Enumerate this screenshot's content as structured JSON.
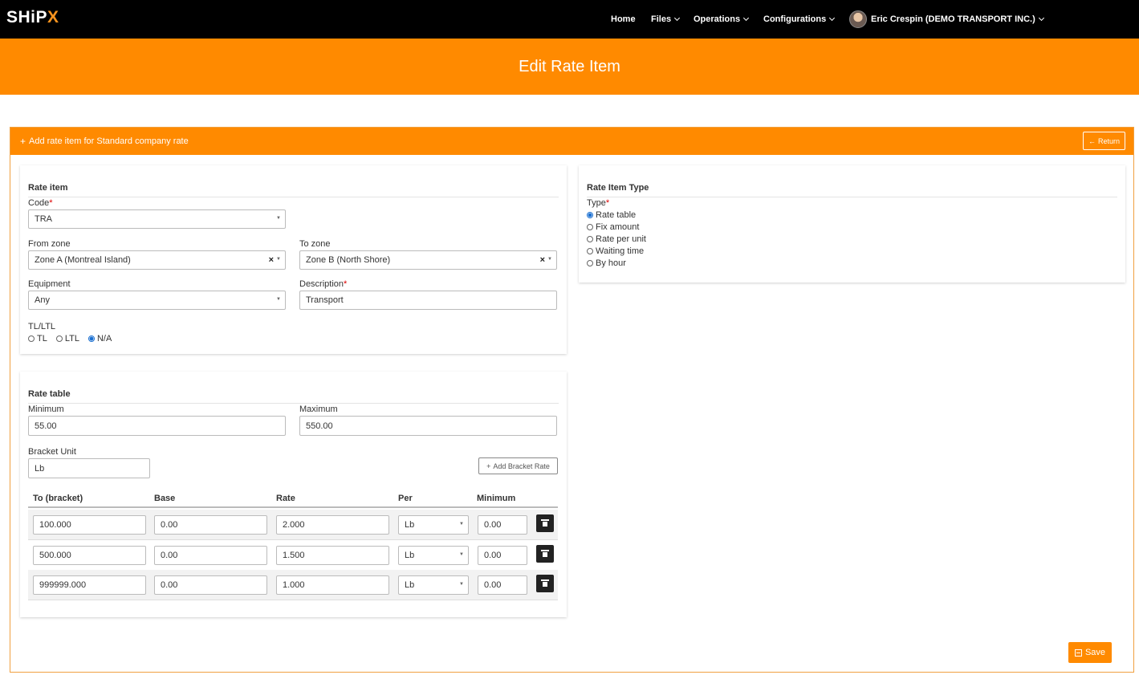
{
  "app": {
    "logo_main": "SHiP",
    "logo_x": "X"
  },
  "nav": {
    "home": "Home",
    "files": "Files",
    "operations": "Operations",
    "configurations": "Configurations",
    "user": "Eric Crespin (DEMO TRANSPORT INC.)"
  },
  "page": {
    "title": "Edit Rate Item"
  },
  "panel": {
    "title": "Add rate item for Standard company rate",
    "return_label": "Return",
    "save_label": "Save"
  },
  "rate_item": {
    "title": "Rate item",
    "code_label": "Code",
    "code_value": "TRA",
    "from_zone_label": "From zone",
    "from_zone_value": "Zone A (Montreal Island)",
    "to_zone_label": "To zone",
    "to_zone_value": "Zone B (North Shore)",
    "equipment_label": "Equipment",
    "equipment_value": "Any",
    "description_label": "Description",
    "description_value": "Transport",
    "tl_ltl_label": "TL/LTL",
    "tl_ltl_options": [
      "TL",
      "LTL",
      "N/A"
    ],
    "tl_ltl_selected": "N/A"
  },
  "rate_item_type": {
    "title": "Rate Item Type",
    "type_label": "Type",
    "options": [
      "Rate table",
      "Fix amount",
      "Rate per unit",
      "Waiting time",
      "By hour"
    ],
    "selected": "Rate table"
  },
  "rate_table": {
    "title": "Rate table",
    "minimum_label": "Minimum",
    "minimum_value": "55.00",
    "maximum_label": "Maximum",
    "maximum_value": "550.00",
    "bracket_unit_label": "Bracket Unit",
    "bracket_unit_value": "Lb",
    "add_bracket_label": "Add Bracket Rate",
    "columns": [
      "To (bracket)",
      "Base",
      "Rate",
      "Per",
      "Minimum"
    ],
    "rows": [
      {
        "to": "100.000",
        "base": "0.00",
        "rate": "2.000",
        "per": "Lb",
        "minimum": "0.00"
      },
      {
        "to": "500.000",
        "base": "0.00",
        "rate": "1.500",
        "per": "Lb",
        "minimum": "0.00"
      },
      {
        "to": "999999.000",
        "base": "0.00",
        "rate": "1.000",
        "per": "Lb",
        "minimum": "0.00"
      }
    ]
  },
  "colors": {
    "accent": "#ff8a00",
    "nav_bg": "#000000",
    "radio_selected": "#1a6fd1",
    "required": "#dd0000"
  },
  "icons": {
    "plus": "plus-icon",
    "return": "arrow-left-icon",
    "trash": "trash-icon",
    "save": "save-icon",
    "chevron": "chevron-down-icon"
  }
}
